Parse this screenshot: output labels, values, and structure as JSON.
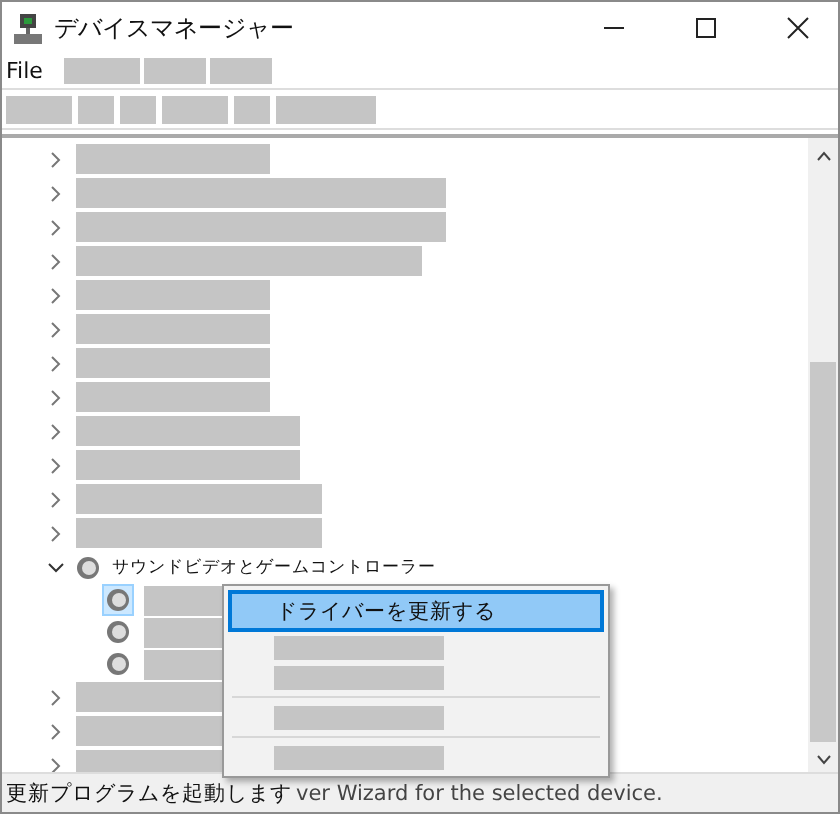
{
  "window": {
    "title": "デバイスマネージャー"
  },
  "menu": [
    {
      "kind": "text",
      "label": "File"
    },
    {
      "kind": "redacted"
    },
    {
      "kind": "redacted"
    },
    {
      "kind": "redacted"
    }
  ],
  "toolbar": [
    {
      "kind": "redacted"
    },
    {
      "kind": "redacted"
    },
    {
      "kind": "redacted"
    },
    {
      "kind": "redacted"
    },
    {
      "kind": "redacted"
    },
    {
      "kind": "redacted"
    }
  ],
  "tree": [
    {
      "kind": "redacted",
      "expanded": false
    },
    {
      "kind": "redacted",
      "expanded": false
    },
    {
      "kind": "redacted",
      "expanded": false
    },
    {
      "kind": "redacted",
      "expanded": false
    },
    {
      "kind": "redacted",
      "expanded": false
    },
    {
      "kind": "redacted",
      "expanded": false
    },
    {
      "kind": "redacted",
      "expanded": false
    },
    {
      "kind": "redacted",
      "expanded": false
    },
    {
      "kind": "redacted",
      "expanded": false
    },
    {
      "kind": "redacted",
      "expanded": false
    },
    {
      "kind": "redacted",
      "expanded": false
    },
    {
      "kind": "redacted",
      "expanded": false
    },
    {
      "kind": "text",
      "label": "サウンドビデオとゲームコントローラー",
      "expanded": true,
      "children": [
        {
          "kind": "redacted",
          "selected": true
        },
        {
          "kind": "redacted",
          "selected": false
        },
        {
          "kind": "redacted",
          "selected": false
        }
      ]
    },
    {
      "kind": "redacted",
      "expanded": false
    },
    {
      "kind": "redacted",
      "expanded": false
    },
    {
      "kind": "redacted",
      "expanded": false
    }
  ],
  "context_menu": [
    {
      "kind": "text",
      "label": "ドライバーを更新する",
      "selected": true
    },
    {
      "kind": "redacted",
      "selected": false
    },
    {
      "kind": "redacted",
      "selected": false
    },
    {
      "kind": "separator"
    },
    {
      "kind": "redacted",
      "selected": false
    },
    {
      "kind": "separator"
    },
    {
      "kind": "redacted",
      "selected": false
    }
  ],
  "status_bar": {
    "texts": [
      "更新プログラムを起動します",
      "ver Wizard for the selected device."
    ]
  }
}
